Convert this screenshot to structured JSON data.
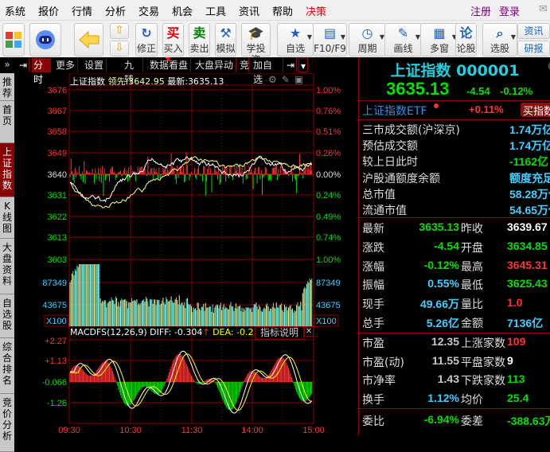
{
  "menu": {
    "items": [
      "系统",
      "报价",
      "行情",
      "分析",
      "交易",
      "机会",
      "工具",
      "资讯",
      "帮助",
      "决策"
    ],
    "register": "注册",
    "login": "登录"
  },
  "toolbar": {
    "buttons": [
      {
        "label": "修正",
        "icon": "refresh-icon"
      },
      {
        "label": "买入",
        "icon": "buy-icon",
        "glyph": "买"
      },
      {
        "label": "卖出",
        "icon": "sell-icon",
        "glyph": "卖"
      },
      {
        "label": "模拟",
        "icon": "gavel-icon"
      },
      {
        "label": "学投资",
        "icon": "graduation-cap-icon"
      },
      {
        "label": "自选",
        "icon": "star-folder-icon"
      },
      {
        "label": "F10/F9",
        "icon": "document-icon"
      },
      {
        "label": "周期",
        "icon": "clock-icon"
      },
      {
        "label": "画线",
        "icon": "pencil-icon"
      },
      {
        "label": "多窗",
        "icon": "windows-icon"
      },
      {
        "label": "论股",
        "icon": "discuss-icon",
        "glyph": "论"
      },
      {
        "label": "选股",
        "icon": "magnifier-chart-icon"
      }
    ],
    "news": "资讯",
    "research": "研报"
  },
  "left_tabs": [
    "推荐",
    "首页",
    "上证指数",
    "K线图",
    "大盘资料",
    "自选股",
    "综合排名",
    "竞价分析"
  ],
  "chart_tabs": {
    "items": [
      "分时",
      "更多",
      "设置",
      "九转",
      "数据看盘",
      "大盘异动",
      "竞",
      "加自选"
    ]
  },
  "chart": {
    "name": "上证指数",
    "lead_label": "领先:",
    "lead_value": "3642.95",
    "latest_label": "最新:",
    "latest_value": "3635.13",
    "price_ticks_left": [
      "3676",
      "3667",
      "3658",
      "3649",
      "3640",
      "3631",
      "3622",
      "3613",
      "3603"
    ],
    "price_ticks_right": [
      "1.00%",
      "0.76%",
      "0.51%",
      "0.26%",
      "0.00%",
      "0.24%",
      "0.49%",
      "0.74%",
      "1.00%"
    ],
    "volume_ticks": [
      "87349",
      "43675"
    ],
    "volume_unit": "X100",
    "macd_header": "MACDFS(12,26,9) DIFF: -0.304",
    "macd_arrow": "↑",
    "macd_dea": "DEA: -0.2",
    "indicator_help": "指标说明",
    "macd_ticks": [
      "+2.27",
      "+1.13",
      "-0.066",
      "-1.26"
    ],
    "time_ticks": [
      "09:30",
      "10:30",
      "11:30",
      "14:00",
      "15:00"
    ],
    "colors": {
      "up": "#ff3232",
      "down": "#00e000",
      "price_line": "#ffffff",
      "avg_line": "#ffff80",
      "grid": "#8b0000",
      "volume": "#40e0e0"
    }
  },
  "quote": {
    "title": "上证指数 000001",
    "price": "3635.13",
    "change": "-4.54",
    "pct": "-0.12%",
    "etf_label": "上证指数ETF",
    "etf_pct": "+0.11%",
    "etf_button": "买指数",
    "stats": [
      {
        "label": "三市成交额(沪深京)",
        "value": "1.74万亿",
        "color": "#40d0ff"
      },
      {
        "label": "预估成交额",
        "value": "1.74万亿",
        "color": "#40d0ff"
      },
      {
        "label": "较上日此时",
        "value": "-1162亿",
        "color": "#00e000"
      },
      {
        "label": "沪股通额度余额",
        "value": "额度充足",
        "color": "#40d0ff"
      },
      {
        "label": "总市值",
        "value": "58.28万亿",
        "color": "#40d0ff"
      },
      {
        "label": "流通市值",
        "value": "54.65万亿",
        "color": "#40d0ff"
      }
    ],
    "grid1": [
      {
        "l1": "最新",
        "v1": "3635.13",
        "c1": "#00e000",
        "l2": "昨收",
        "v2": "3639.67",
        "c2": "#ffffff"
      },
      {
        "l1": "涨跌",
        "v1": "-4.54",
        "c1": "#00e000",
        "l2": "开盘",
        "v2": "3634.85",
        "c2": "#00e000"
      },
      {
        "l1": "涨幅",
        "v1": "-0.12%",
        "c1": "#00e000",
        "l2": "最高",
        "v2": "3645.31",
        "c2": "#ff3232"
      },
      {
        "l1": "振幅",
        "v1": "0.55%",
        "c1": "#40d0ff",
        "l2": "最低",
        "v2": "3625.43",
        "c2": "#00e000"
      },
      {
        "l1": "现手",
        "v1": "49.66万",
        "c1": "#40d0ff",
        "l2": "量比",
        "v2": "1.0",
        "c2": "#ff3232"
      },
      {
        "l1": "总手",
        "v1": "5.26亿",
        "c1": "#40d0ff",
        "l2": "金额",
        "v2": "7136亿",
        "c2": "#40d0ff"
      }
    ],
    "grid2": [
      {
        "l1": "市盈",
        "v1": "12.35",
        "c1": "#c8c8c8",
        "l2": "上涨家数",
        "v2": "109",
        "c2": "#ff3232"
      },
      {
        "l1": "市盈(动)",
        "v1": "11.55",
        "c1": "#c8c8c8",
        "l2": "平盘家数",
        "v2": "9",
        "c2": "#ffffff"
      },
      {
        "l1": "市净率",
        "v1": "1.43",
        "c1": "#c8c8c8",
        "l2": "下跌家数",
        "v2": "113",
        "c2": "#00e000"
      },
      {
        "l1": "换手",
        "v1": "1.12%",
        "c1": "#40d0ff",
        "l2": "均价",
        "v2": "25.4",
        "c2": "#00e000"
      }
    ],
    "grid3": [
      {
        "l1": "委比",
        "v1": "-6.94%",
        "c1": "#00e000",
        "l2": "委差",
        "v2": "-388.63万",
        "c2": "#00e000"
      }
    ]
  }
}
